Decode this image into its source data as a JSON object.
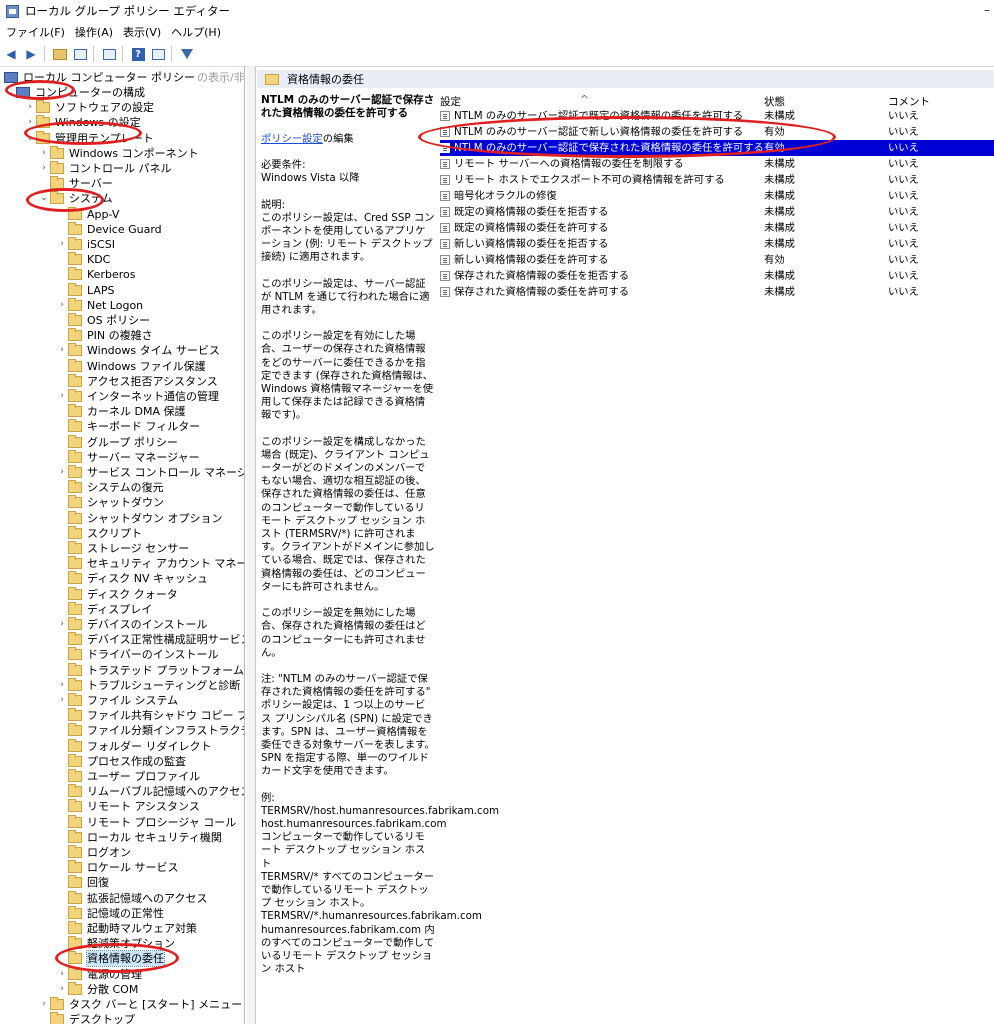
{
  "window": {
    "title": "ローカル グループ ポリシー エディター",
    "minimize": "–"
  },
  "menu": [
    "ファイル(F)",
    "操作(A)",
    "表示(V)",
    "ヘルプ(H)"
  ],
  "toolbar": [
    "back-icon",
    "forward-icon",
    "up-folder-icon",
    "show-hide-tree-icon",
    "export-list-icon",
    "help-icon",
    "properties-icon",
    "filter-icon"
  ],
  "tree": {
    "root": "ローカル コンピューター ポリシー",
    "root_hint": "の表示/非表示",
    "items": [
      {
        "label": "コンピューターの構成",
        "level": 1,
        "expander": "⌄",
        "icon": "computer"
      },
      {
        "label": "ソフトウェアの設定",
        "level": 2,
        "expander": "›",
        "icon": "folder"
      },
      {
        "label": "Windows の設定",
        "level": 2,
        "expander": "›",
        "icon": "folder"
      },
      {
        "label": "管理用テンプレート",
        "level": 2,
        "expander": "⌄",
        "icon": "folder"
      },
      {
        "label": "Windows コンポーネント",
        "level": 3,
        "expander": "›",
        "icon": "folder"
      },
      {
        "label": "コントロール パネル",
        "level": 3,
        "expander": "›",
        "icon": "folder"
      },
      {
        "label": "サーバー",
        "level": 3,
        "expander": "",
        "icon": "folder"
      },
      {
        "label": "システム",
        "level": 3,
        "expander": "⌄",
        "icon": "folder"
      },
      {
        "label": "App-V",
        "level": 4,
        "expander": "",
        "icon": "folder"
      },
      {
        "label": "Device Guard",
        "level": 4,
        "expander": "",
        "icon": "folder"
      },
      {
        "label": "iSCSI",
        "level": 4,
        "expander": "›",
        "icon": "folder"
      },
      {
        "label": "KDC",
        "level": 4,
        "expander": "",
        "icon": "folder"
      },
      {
        "label": "Kerberos",
        "level": 4,
        "expander": "",
        "icon": "folder"
      },
      {
        "label": "LAPS",
        "level": 4,
        "expander": "",
        "icon": "folder"
      },
      {
        "label": "Net Logon",
        "level": 4,
        "expander": "›",
        "icon": "folder"
      },
      {
        "label": "OS ポリシー",
        "level": 4,
        "expander": "",
        "icon": "folder"
      },
      {
        "label": "PIN の複雑さ",
        "level": 4,
        "expander": "",
        "icon": "folder"
      },
      {
        "label": "Windows タイム サービス",
        "level": 4,
        "expander": "›",
        "icon": "folder"
      },
      {
        "label": "Windows ファイル保護",
        "level": 4,
        "expander": "",
        "icon": "folder"
      },
      {
        "label": "アクセス拒否アシスタンス",
        "level": 4,
        "expander": "",
        "icon": "folder"
      },
      {
        "label": "インターネット通信の管理",
        "level": 4,
        "expander": "›",
        "icon": "folder"
      },
      {
        "label": "カーネル DMA 保護",
        "level": 4,
        "expander": "",
        "icon": "folder"
      },
      {
        "label": "キーボード フィルター",
        "level": 4,
        "expander": "",
        "icon": "folder"
      },
      {
        "label": "グループ ポリシー",
        "level": 4,
        "expander": "",
        "icon": "folder"
      },
      {
        "label": "サーバー マネージャー",
        "level": 4,
        "expander": "",
        "icon": "folder"
      },
      {
        "label": "サービス コントロール マネージャーの設定",
        "level": 4,
        "expander": "›",
        "icon": "folder"
      },
      {
        "label": "システムの復元",
        "level": 4,
        "expander": "",
        "icon": "folder"
      },
      {
        "label": "シャットダウン",
        "level": 4,
        "expander": "",
        "icon": "folder"
      },
      {
        "label": "シャットダウン オプション",
        "level": 4,
        "expander": "",
        "icon": "folder"
      },
      {
        "label": "スクリプト",
        "level": 4,
        "expander": "",
        "icon": "folder"
      },
      {
        "label": "ストレージ センサー",
        "level": 4,
        "expander": "",
        "icon": "folder"
      },
      {
        "label": "セキュリティ アカウント マネージャー",
        "level": 4,
        "expander": "",
        "icon": "folder"
      },
      {
        "label": "ディスク NV キャッシュ",
        "level": 4,
        "expander": "",
        "icon": "folder"
      },
      {
        "label": "ディスク クォータ",
        "level": 4,
        "expander": "",
        "icon": "folder"
      },
      {
        "label": "ディスプレイ",
        "level": 4,
        "expander": "",
        "icon": "folder"
      },
      {
        "label": "デバイスのインストール",
        "level": 4,
        "expander": "›",
        "icon": "folder"
      },
      {
        "label": "デバイス正常性構成証明サービス",
        "level": 4,
        "expander": "",
        "icon": "folder"
      },
      {
        "label": "ドライバーのインストール",
        "level": 4,
        "expander": "",
        "icon": "folder"
      },
      {
        "label": "トラステッド プラットフォーム モジュール サ:",
        "level": 4,
        "expander": "",
        "icon": "folder"
      },
      {
        "label": "トラブルシューティングと診断",
        "level": 4,
        "expander": "›",
        "icon": "folder"
      },
      {
        "label": "ファイル システム",
        "level": 4,
        "expander": "›",
        "icon": "folder"
      },
      {
        "label": "ファイル共有シャドウ コピー プロバイダー",
        "level": 4,
        "expander": "",
        "icon": "folder"
      },
      {
        "label": "ファイル分類インフラストラクチャ",
        "level": 4,
        "expander": "",
        "icon": "folder"
      },
      {
        "label": "フォルダー リダイレクト",
        "level": 4,
        "expander": "",
        "icon": "folder"
      },
      {
        "label": "プロセス作成の監査",
        "level": 4,
        "expander": "",
        "icon": "folder"
      },
      {
        "label": "ユーザー プロファイル",
        "level": 4,
        "expander": "",
        "icon": "folder"
      },
      {
        "label": "リムーバブル記憶域へのアクセス",
        "level": 4,
        "expander": "",
        "icon": "folder"
      },
      {
        "label": "リモート アシスタンス",
        "level": 4,
        "expander": "",
        "icon": "folder"
      },
      {
        "label": "リモート プロシージャ コール",
        "level": 4,
        "expander": "",
        "icon": "folder"
      },
      {
        "label": "ローカル セキュリティ機関",
        "level": 4,
        "expander": "",
        "icon": "folder"
      },
      {
        "label": "ログオン",
        "level": 4,
        "expander": "",
        "icon": "folder"
      },
      {
        "label": "ロケール サービス",
        "level": 4,
        "expander": "",
        "icon": "folder"
      },
      {
        "label": "回復",
        "level": 4,
        "expander": "",
        "icon": "folder"
      },
      {
        "label": "拡張記憶域へのアクセス",
        "level": 4,
        "expander": "",
        "icon": "folder"
      },
      {
        "label": "記憶域の正常性",
        "level": 4,
        "expander": "",
        "icon": "folder"
      },
      {
        "label": "起動時マルウェア対策",
        "level": 4,
        "expander": "",
        "icon": "folder"
      },
      {
        "label": "軽減策オプション",
        "level": 4,
        "expander": "",
        "icon": "folder"
      },
      {
        "label": "資格情報の委任",
        "level": 4,
        "expander": "",
        "icon": "folder",
        "selected": true
      },
      {
        "label": "電源の管理",
        "level": 4,
        "expander": "›",
        "icon": "folder"
      },
      {
        "label": "分散 COM",
        "level": 4,
        "expander": "›",
        "icon": "folder"
      },
      {
        "label": "タスク バーと [スタート] メニュー",
        "level": 3,
        "expander": "›",
        "icon": "folder"
      },
      {
        "label": "デスクトップ",
        "level": 3,
        "expander": "",
        "icon": "folder"
      }
    ]
  },
  "main": {
    "header": "資格情報の委任",
    "policy_title": "NTLM のみのサーバー認証で保存された資格情報の委任を許可する",
    "edit_link": "ポリシー設定",
    "edit_suffix": "の編集",
    "requirements_label": "必要条件:",
    "requirements_value": "Windows Vista 以降",
    "description": [
      "説明:\nこのポリシー設定は、Cred SSP コンポーネントを使用しているアプリケーション (例: リモート デスクトップ接続) に適用されます。",
      "このポリシー設定は、サーバー認証が NTLM を通じて行われた場合に適用されます。",
      "このポリシー設定を有効にした場合、ユーザーの保存された資格情報をどのサーバーに委任できるかを指定できます (保存された資格情報は、Windows 資格情報マネージャーを使用して保存または記録できる資格情報です)。",
      "このポリシー設定を構成しなかった場合 (既定)、クライアント コンピューターがどのドメインのメンバーでもない場合、適切な相互認証の後、保存された資格情報の委任は、任意のコンピューターで動作しているリモート デスクトップ セッション ホスト (TERMSRV/*) に許可されます。クライアントがドメインに参加している場合、既定では、保存された資格情報の委任は、どのコンピューターにも許可されません。",
      "このポリシー設定を無効にした場合、保存された資格情報の委任はどのコンピューターにも許可されません。",
      "注: \"NTLM のみのサーバー認証で保存された資格情報の委任を許可する\" ポリシー設定は、1 つ以上のサービス プリンシパル名 (SPN) に設定できます。SPN は、ユーザー資格情報を委任できる対象サーバーを表します。SPN を指定する際、単一のワイルドカード文字を使用できます。",
      "例:\nTERMSRV/host.humanresources.fabrikam.com\nhost.humanresources.fabrikam.com コンピューターで動作しているリモート デスクトップ セッション ホスト\nTERMSRV/* すべてのコンピューターで動作しているリモート デスクトップ セッション ホスト。\nTERMSRV/*.humanresources.fabrikam.com humanresources.fabrikam.com 内のすべてのコンピューターで動作しているリモート デスクトップ セッション ホスト"
    ],
    "columns": {
      "setting": "設定",
      "state": "状態",
      "comment": "コメント",
      "sort_indicator": "^"
    },
    "rows": [
      {
        "name": "NTLM のみのサーバー認証で既定の資格情報の委任を許可する",
        "state": "未構成",
        "comment": "いいえ"
      },
      {
        "name": "NTLM のみのサーバー認証で新しい資格情報の委任を許可する",
        "state": "有効",
        "comment": "いいえ"
      },
      {
        "name": "NTLM のみのサーバー認証で保存された資格情報の委任を許可する",
        "state": "有効",
        "comment": "いいえ",
        "selected": true
      },
      {
        "name": "リモート サーバーへの資格情報の委任を制限する",
        "state": "未構成",
        "comment": "いいえ"
      },
      {
        "name": "リモート ホストでエクスポート不可の資格情報を許可する",
        "state": "未構成",
        "comment": "いいえ"
      },
      {
        "name": "暗号化オラクルの修復",
        "state": "未構成",
        "comment": "いいえ"
      },
      {
        "name": "既定の資格情報の委任を拒否する",
        "state": "未構成",
        "comment": "いいえ"
      },
      {
        "name": "既定の資格情報の委任を許可する",
        "state": "未構成",
        "comment": "いいえ"
      },
      {
        "name": "新しい資格情報の委任を拒否する",
        "state": "未構成",
        "comment": "いいえ"
      },
      {
        "name": "新しい資格情報の委任を許可する",
        "state": "有効",
        "comment": "いいえ"
      },
      {
        "name": "保存された資格情報の委任を拒否する",
        "state": "未構成",
        "comment": "いいえ"
      },
      {
        "name": "保存された資格情報の委任を許可する",
        "state": "未構成",
        "comment": "いいえ"
      }
    ]
  },
  "annotation_color": "#e02020",
  "selection_color": "#0000d6"
}
